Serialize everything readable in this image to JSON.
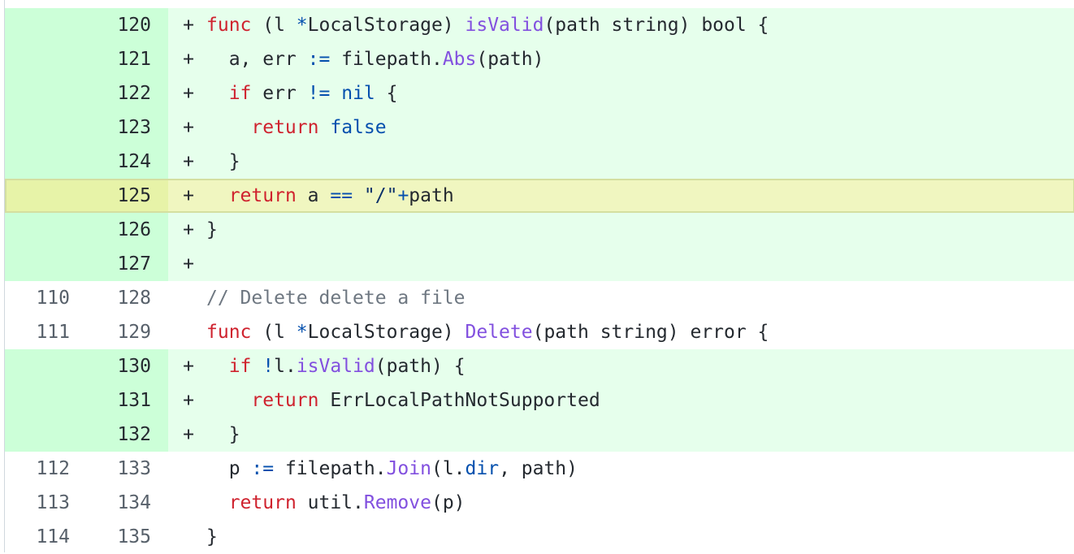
{
  "colors": {
    "added_bg": "#e6ffec",
    "added_gutter": "#ccffd8",
    "highlight_bg": "#f0f6c0",
    "keyword": "#cf222e",
    "function": "#8250df",
    "constant": "#0550ae",
    "comment": "#6e7781"
  },
  "lines": [
    {
      "type": "add",
      "old": "",
      "new": "120",
      "marker": "+",
      "tokens": [
        {
          "t": "func",
          "c": "k"
        },
        {
          "t": " (l ",
          "c": ""
        },
        {
          "t": "*",
          "c": "c"
        },
        {
          "t": "LocalStorage) ",
          "c": ""
        },
        {
          "t": "isValid",
          "c": "f"
        },
        {
          "t": "(path string) bool {",
          "c": ""
        }
      ]
    },
    {
      "type": "add",
      "old": "",
      "new": "121",
      "marker": "+",
      "tokens": [
        {
          "t": "  a, err ",
          "c": ""
        },
        {
          "t": ":=",
          "c": "c"
        },
        {
          "t": " filepath.",
          "c": ""
        },
        {
          "t": "Abs",
          "c": "f"
        },
        {
          "t": "(path)",
          "c": ""
        }
      ]
    },
    {
      "type": "add",
      "old": "",
      "new": "122",
      "marker": "+",
      "tokens": [
        {
          "t": "  ",
          "c": ""
        },
        {
          "t": "if",
          "c": "k"
        },
        {
          "t": " err ",
          "c": ""
        },
        {
          "t": "!=",
          "c": "c"
        },
        {
          "t": " ",
          "c": ""
        },
        {
          "t": "nil",
          "c": "c"
        },
        {
          "t": " {",
          "c": ""
        }
      ]
    },
    {
      "type": "add",
      "old": "",
      "new": "123",
      "marker": "+",
      "tokens": [
        {
          "t": "    ",
          "c": ""
        },
        {
          "t": "return",
          "c": "k"
        },
        {
          "t": " ",
          "c": ""
        },
        {
          "t": "false",
          "c": "c"
        }
      ]
    },
    {
      "type": "add",
      "old": "",
      "new": "124",
      "marker": "+",
      "tokens": [
        {
          "t": "  }",
          "c": ""
        }
      ]
    },
    {
      "type": "hl",
      "old": "",
      "new": "125",
      "marker": "+",
      "tokens": [
        {
          "t": "  ",
          "c": ""
        },
        {
          "t": "return",
          "c": "k"
        },
        {
          "t": " a ",
          "c": ""
        },
        {
          "t": "==",
          "c": "c"
        },
        {
          "t": " \"/\"",
          "c": "s"
        },
        {
          "t": "+",
          "c": "c"
        },
        {
          "t": "path",
          "c": ""
        }
      ]
    },
    {
      "type": "add",
      "old": "",
      "new": "126",
      "marker": "+",
      "tokens": [
        {
          "t": "}",
          "c": ""
        }
      ]
    },
    {
      "type": "add",
      "old": "",
      "new": "127",
      "marker": "+",
      "tokens": []
    },
    {
      "type": "ctx",
      "old": "110",
      "new": "128",
      "marker": "",
      "tokens": [
        {
          "t": "// Delete delete a file",
          "c": "cm"
        }
      ]
    },
    {
      "type": "ctx",
      "old": "111",
      "new": "129",
      "marker": "",
      "tokens": [
        {
          "t": "func",
          "c": "k"
        },
        {
          "t": " (l ",
          "c": ""
        },
        {
          "t": "*",
          "c": "c"
        },
        {
          "t": "LocalStorage) ",
          "c": ""
        },
        {
          "t": "Delete",
          "c": "f"
        },
        {
          "t": "(path string) error {",
          "c": ""
        }
      ]
    },
    {
      "type": "add",
      "old": "",
      "new": "130",
      "marker": "+",
      "tokens": [
        {
          "t": "  ",
          "c": ""
        },
        {
          "t": "if",
          "c": "k"
        },
        {
          "t": " ",
          "c": ""
        },
        {
          "t": "!",
          "c": "c"
        },
        {
          "t": "l.",
          "c": ""
        },
        {
          "t": "isValid",
          "c": "f"
        },
        {
          "t": "(path) {",
          "c": ""
        }
      ]
    },
    {
      "type": "add",
      "old": "",
      "new": "131",
      "marker": "+",
      "tokens": [
        {
          "t": "    ",
          "c": ""
        },
        {
          "t": "return",
          "c": "k"
        },
        {
          "t": " ErrLocalPathNotSupported",
          "c": ""
        }
      ]
    },
    {
      "type": "add",
      "old": "",
      "new": "132",
      "marker": "+",
      "tokens": [
        {
          "t": "  }",
          "c": ""
        }
      ]
    },
    {
      "type": "ctx",
      "old": "112",
      "new": "133",
      "marker": "",
      "tokens": [
        {
          "t": "  p ",
          "c": ""
        },
        {
          "t": ":=",
          "c": "c"
        },
        {
          "t": " filepath.",
          "c": ""
        },
        {
          "t": "Join",
          "c": "f"
        },
        {
          "t": "(l.",
          "c": ""
        },
        {
          "t": "dir",
          "c": "c"
        },
        {
          "t": ", path)",
          "c": ""
        }
      ]
    },
    {
      "type": "ctx",
      "old": "113",
      "new": "134",
      "marker": "",
      "tokens": [
        {
          "t": "  ",
          "c": ""
        },
        {
          "t": "return",
          "c": "k"
        },
        {
          "t": " util.",
          "c": ""
        },
        {
          "t": "Remove",
          "c": "f"
        },
        {
          "t": "(p)",
          "c": ""
        }
      ]
    },
    {
      "type": "ctx",
      "old": "114",
      "new": "135",
      "marker": "",
      "tokens": [
        {
          "t": "}",
          "c": ""
        }
      ]
    }
  ]
}
